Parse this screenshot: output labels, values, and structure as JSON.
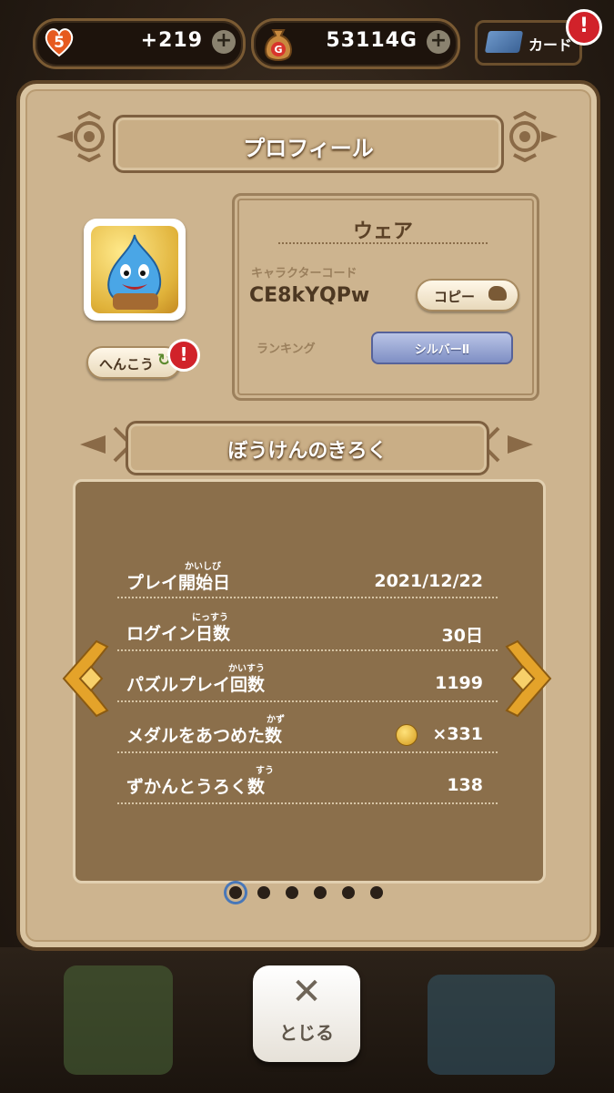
{
  "topbar": {
    "stamina_level": "5",
    "stamina_value": "+219",
    "gold_icon_letter": "G",
    "gold_value": "53114G",
    "plus_symbol": "+",
    "card_label": "カード",
    "alert_symbol": "!"
  },
  "profile": {
    "title": "プロフィール",
    "change_button": "へんこう",
    "player_name": "ウェア",
    "character_code_label": "キャラクターコード",
    "character_code": "CE8kYQPw",
    "copy_button": "コピー",
    "ranking_label": "ランキング",
    "ranking_value": "シルバーⅡ"
  },
  "record": {
    "title": "ぼうけんのきろく",
    "rows": [
      {
        "label": "プレイ開始日",
        "ruby": "かいしび",
        "value": "2021/12/22"
      },
      {
        "label": "ログイン日数",
        "ruby": "にっすう",
        "value": "30日"
      },
      {
        "label": "パズルプレイ回数",
        "ruby": "かいすう",
        "value": "1199"
      },
      {
        "label": "メダルをあつめた数",
        "ruby": "かず",
        "value": "×331"
      },
      {
        "label": "ずかんとうろく数",
        "ruby": "すう",
        "value": "138"
      }
    ],
    "page_count": 6,
    "active_page": 1
  },
  "close_button": {
    "symbol": "✕",
    "label": "とじる"
  },
  "colors": {
    "panel": "#cdb48f",
    "stats_bg": "#8b6f4b",
    "alert": "#d1222a",
    "arrow_gold": "#e4a32a"
  }
}
